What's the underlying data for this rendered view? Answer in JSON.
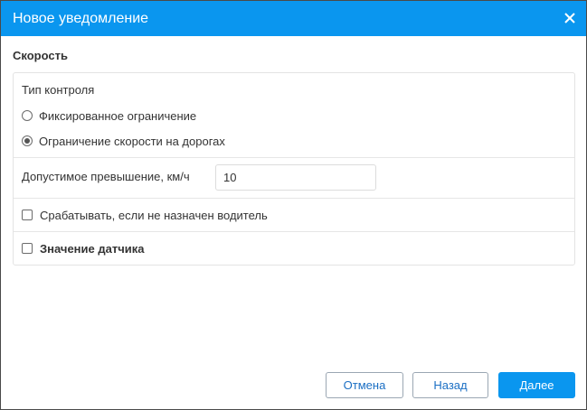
{
  "dialog": {
    "title": "Новое уведомление",
    "close_icon": "close-icon"
  },
  "section": {
    "title": "Скорость"
  },
  "control_type": {
    "label": "Тип контроля",
    "options": [
      {
        "label": "Фиксированное ограничение",
        "checked": false
      },
      {
        "label": "Ограничение скорости на дорогах",
        "checked": true
      }
    ]
  },
  "excess": {
    "label": "Допустимое превышение, км/ч",
    "value": "10"
  },
  "checkboxes": [
    {
      "label": "Срабатывать, если не назначен водитель",
      "checked": false
    },
    {
      "label": "Значение датчика",
      "checked": false
    }
  ],
  "footer": {
    "cancel_label": "Отмена",
    "back_label": "Назад",
    "next_label": "Далее"
  },
  "colors": {
    "accent": "#0a96ef",
    "link_text": "#1b6fc4"
  }
}
